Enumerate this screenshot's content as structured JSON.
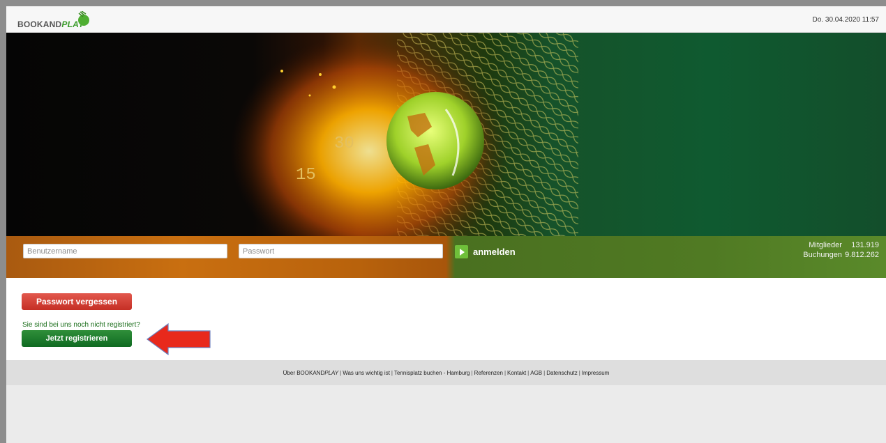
{
  "header": {
    "logo": {
      "part_a": "BOOKAND",
      "part_b": "PLAY"
    },
    "datetime": "Do. 30.04.2020 11:57"
  },
  "hero": {
    "score_top": "30",
    "score_bottom": "15"
  },
  "login": {
    "username_placeholder": "Benutzername",
    "password_placeholder": "Passwort",
    "submit_label": "anmelden",
    "stats": [
      {
        "label": "Mitglieder",
        "value": "131.919"
      },
      {
        "label": "Buchungen",
        "value": "9.812.262"
      }
    ]
  },
  "actions": {
    "forgot_password": "Passwort vergessen",
    "not_registered": "Sie sind bei uns noch nicht registriert?",
    "register": "Jetzt registrieren"
  },
  "footer": {
    "links": [
      {
        "pre": "Über BOOKAND",
        "em": "PLAY"
      },
      {
        "pre": "Was uns wichtig ist"
      },
      {
        "pre": "Tennisplatz buchen - Hamburg"
      },
      {
        "pre": "Referenzen"
      },
      {
        "pre": "Kontakt"
      },
      {
        "pre": "AGB"
      },
      {
        "pre": "Datenschutz"
      },
      {
        "pre": "Impressum"
      }
    ],
    "separator": "|"
  },
  "colors": {
    "accent_green": "#1a6d1a",
    "button_red": "#c52f25",
    "button_green": "#0f6a22",
    "arrow_red": "#e8291c"
  },
  "icons": {
    "logo": "tennis-ball-logo-icon",
    "login": "play-icon",
    "annotation": "left-arrow-icon"
  }
}
